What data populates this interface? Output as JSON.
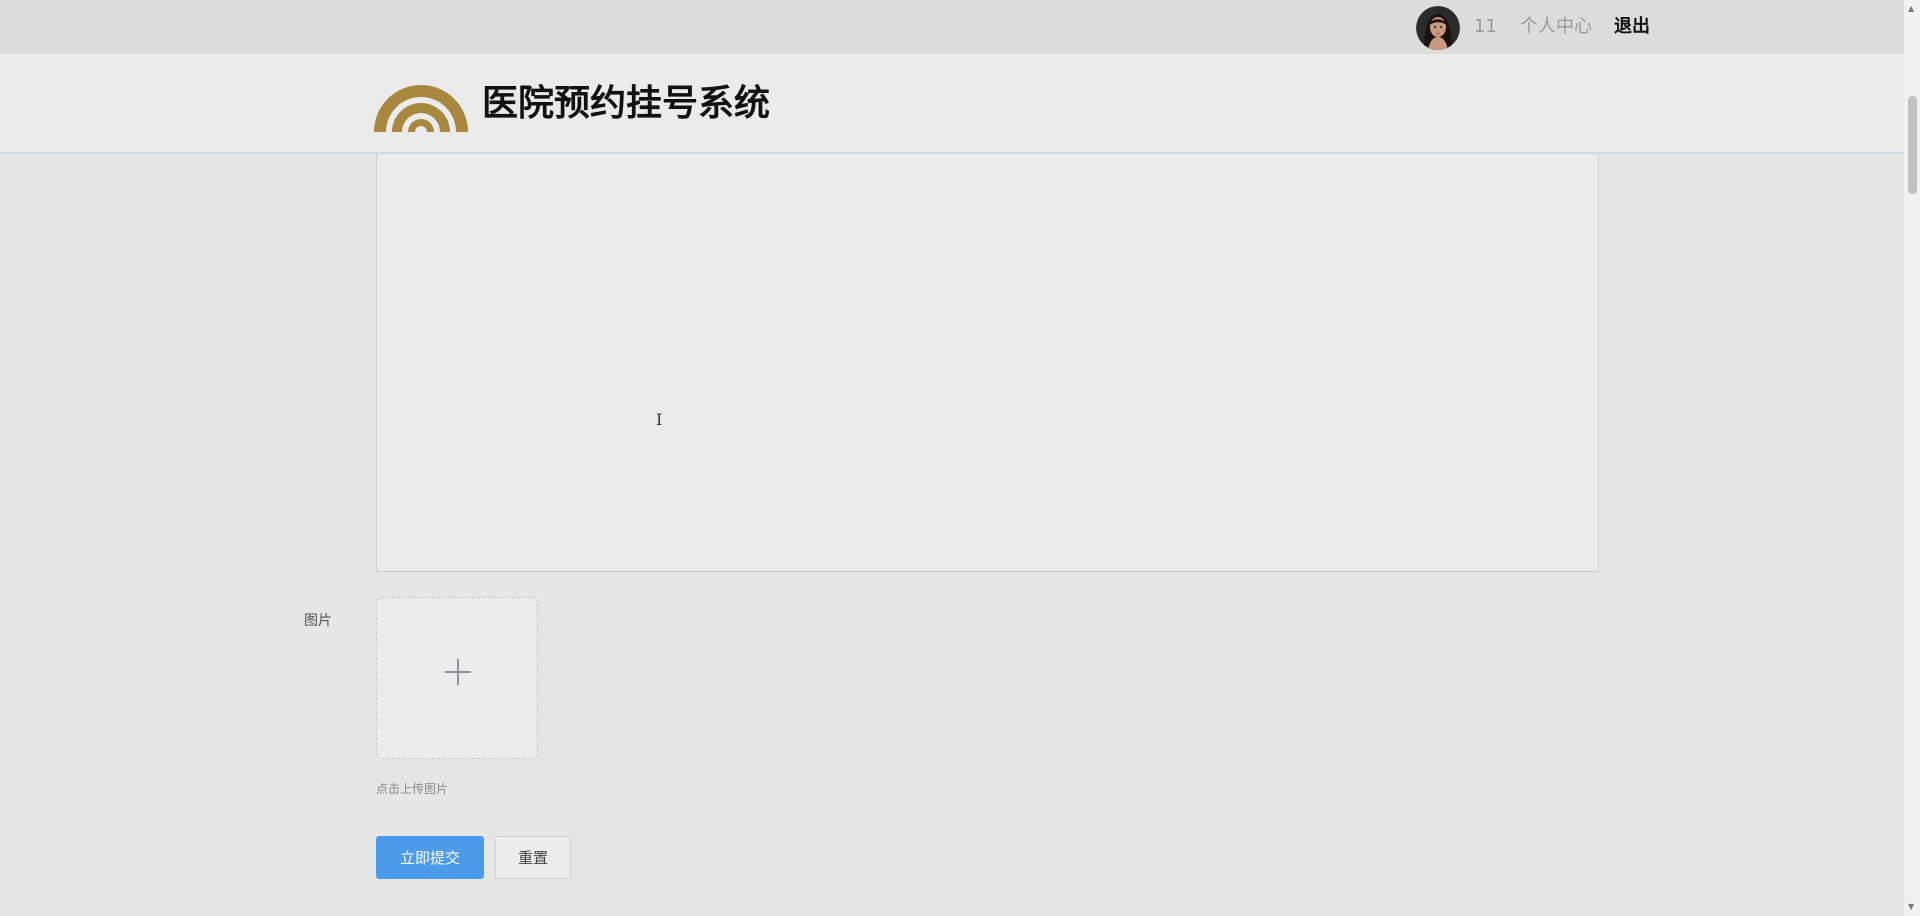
{
  "topbar": {
    "username": "11",
    "personal_center": "个人中心",
    "logout": "退出"
  },
  "header": {
    "site_title": "医院预约挂号系统",
    "logo_color": "#a8883f"
  },
  "form": {
    "image_label": "图片",
    "upload_hint": "点击上传图片",
    "submit_label": "立即提交",
    "reset_label": "重置"
  },
  "colors": {
    "primary": "#4a9be9",
    "background": "#e6e6e6"
  }
}
